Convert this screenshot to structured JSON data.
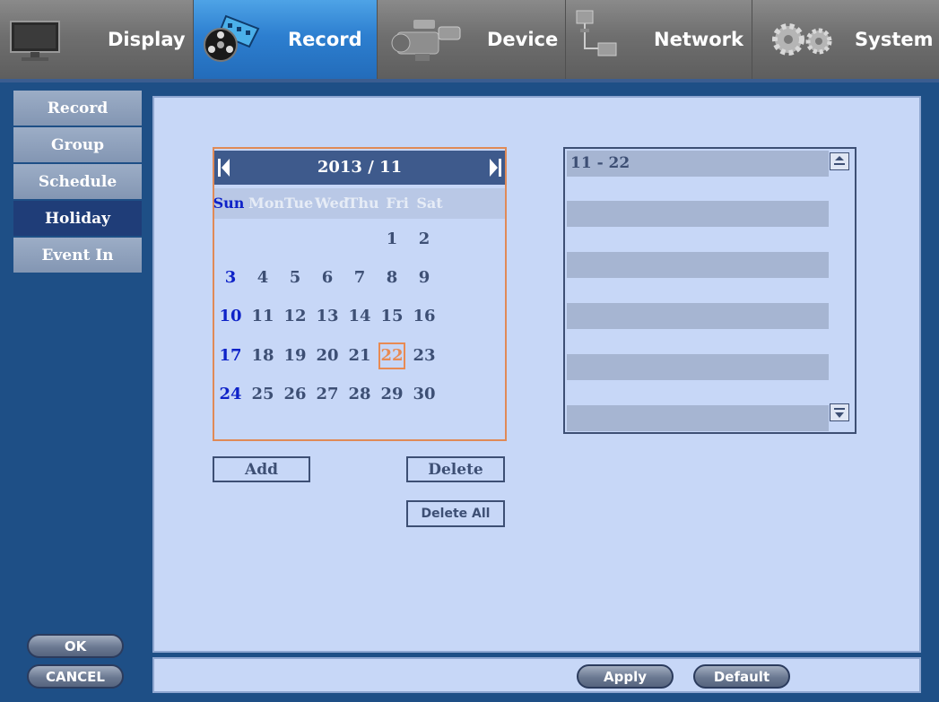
{
  "nav": {
    "tabs": [
      {
        "label": "Display",
        "icon": "monitor-icon",
        "active": false
      },
      {
        "label": "Record",
        "icon": "film-reel-icon",
        "active": true
      },
      {
        "label": "Device",
        "icon": "camcorder-icon",
        "active": false
      },
      {
        "label": "Network",
        "icon": "network-icon",
        "active": false
      },
      {
        "label": "System",
        "icon": "gears-icon",
        "active": false
      }
    ]
  },
  "sidebar": {
    "items": [
      {
        "label": "Record"
      },
      {
        "label": "Group"
      },
      {
        "label": "Schedule"
      },
      {
        "label": "Holiday"
      },
      {
        "label": "Event In"
      }
    ],
    "ok_label": "OK",
    "cancel_label": "CANCEL"
  },
  "calendar": {
    "title": "2013 / 11",
    "weekdays": [
      "Sun",
      "Mon",
      "Tue",
      "Wed",
      "Thu",
      "Fri",
      "Sat"
    ],
    "weeks": [
      [
        "",
        "",
        "",
        "",
        "",
        "1",
        "2"
      ],
      [
        "3",
        "4",
        "5",
        "6",
        "7",
        "8",
        "9"
      ],
      [
        "10",
        "11",
        "12",
        "13",
        "14",
        "15",
        "16"
      ],
      [
        "17",
        "18",
        "19",
        "20",
        "21",
        "22",
        "23"
      ],
      [
        "24",
        "25",
        "26",
        "27",
        "28",
        "29",
        "30"
      ]
    ],
    "selected_day": "22"
  },
  "buttons": {
    "add": "Add",
    "delete": "Delete",
    "delete_all": "Delete All",
    "apply": "Apply",
    "default": "Default"
  },
  "holiday_list": {
    "entries": [
      "11 - 22",
      "",
      "",
      "",
      "",
      "",
      "",
      "",
      "",
      "",
      ""
    ]
  },
  "colors": {
    "accent_active_tab": "#2d7fd0",
    "sunday": "#0e22c8",
    "selected_day": "#e88a53",
    "panel_bg": "#c7d7f7"
  }
}
